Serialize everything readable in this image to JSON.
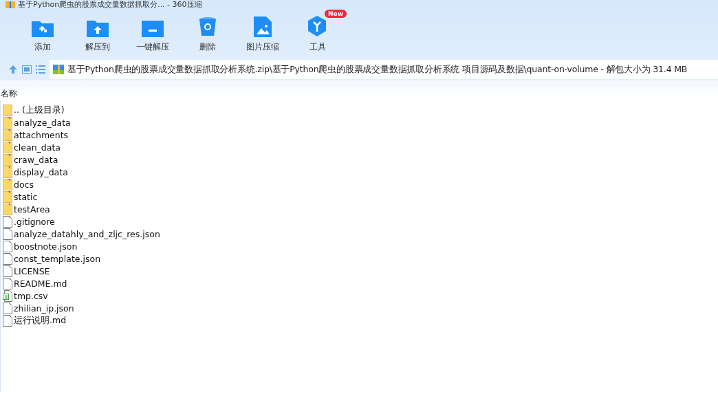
{
  "window": {
    "title": "基于Python爬虫的股票成交量数据抓取分... - 360压缩"
  },
  "toolbar": [
    {
      "label": "添加",
      "kind": "add"
    },
    {
      "label": "解压到",
      "kind": "extract"
    },
    {
      "label": "一键解压",
      "kind": "oneclick"
    },
    {
      "label": "删除",
      "kind": "delete"
    },
    {
      "label": "图片压缩",
      "kind": "image"
    },
    {
      "label": "工具",
      "kind": "tools",
      "badge": "New"
    }
  ],
  "address": {
    "path": "基于Python爬虫的股票成交量数据抓取分析系统.zip\\基于Python爬虫的股票成交量数据抓取分析系统 项目源码及数据\\quant-on-volume - 解包大小为 31.4 MB"
  },
  "table": {
    "columns": [
      "名称"
    ],
    "rows": [
      {
        "name": ".. (上级目录)",
        "kind": "parent"
      },
      {
        "name": "analyze_data",
        "kind": "folder"
      },
      {
        "name": "attachments",
        "kind": "folder"
      },
      {
        "name": "clean_data",
        "kind": "folder"
      },
      {
        "name": "craw_data",
        "kind": "folder"
      },
      {
        "name": "display_data",
        "kind": "folder"
      },
      {
        "name": "docs",
        "kind": "folder"
      },
      {
        "name": "static",
        "kind": "folder"
      },
      {
        "name": "testArea",
        "kind": "folder"
      },
      {
        "name": ".gitignore",
        "kind": "file"
      },
      {
        "name": "analyze_datahly_and_zljc_res.json",
        "kind": "file"
      },
      {
        "name": "boostnote.json",
        "kind": "file"
      },
      {
        "name": "const_template.json",
        "kind": "file"
      },
      {
        "name": "LICENSE",
        "kind": "file"
      },
      {
        "name": "README.md",
        "kind": "file"
      },
      {
        "name": "tmp.csv",
        "kind": "csv"
      },
      {
        "name": "zhilian_ip.json",
        "kind": "file"
      },
      {
        "name": "运行说明.md",
        "kind": "file"
      }
    ]
  }
}
